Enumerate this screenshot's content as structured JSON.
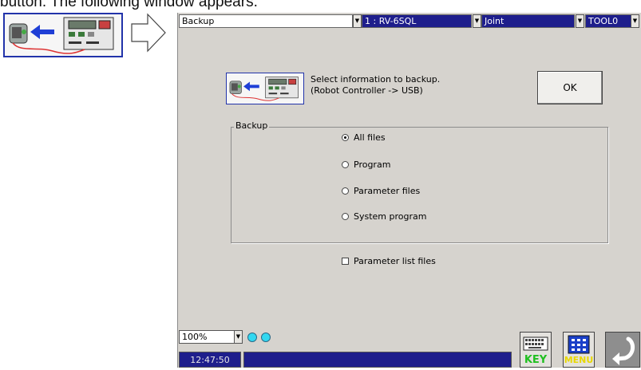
{
  "caption": "button. The following window appears.",
  "header": {
    "function_select": "Backup",
    "robot_select": "1 : RV-6SQL",
    "jog_mode_select": "Joint",
    "tool_select": "TOOL0"
  },
  "message": {
    "line1": "Select information to backup.",
    "line2": "(Robot Controller -> USB)"
  },
  "ok_label": "OK",
  "backup_group": {
    "legend": "Backup",
    "options": [
      "All files",
      "Program",
      "Parameter files",
      "System program"
    ],
    "selected": "All files"
  },
  "parameter_list_files_label": "Parameter list files",
  "zoom": "100%",
  "clock": "12:47:50",
  "buttons": {
    "key_label": "KEY",
    "menu_label": "MENU"
  },
  "colors": {
    "screen_background": "#d6d3ce",
    "status_bar": "#1e1e8c",
    "indicator": "#33d8f0"
  }
}
